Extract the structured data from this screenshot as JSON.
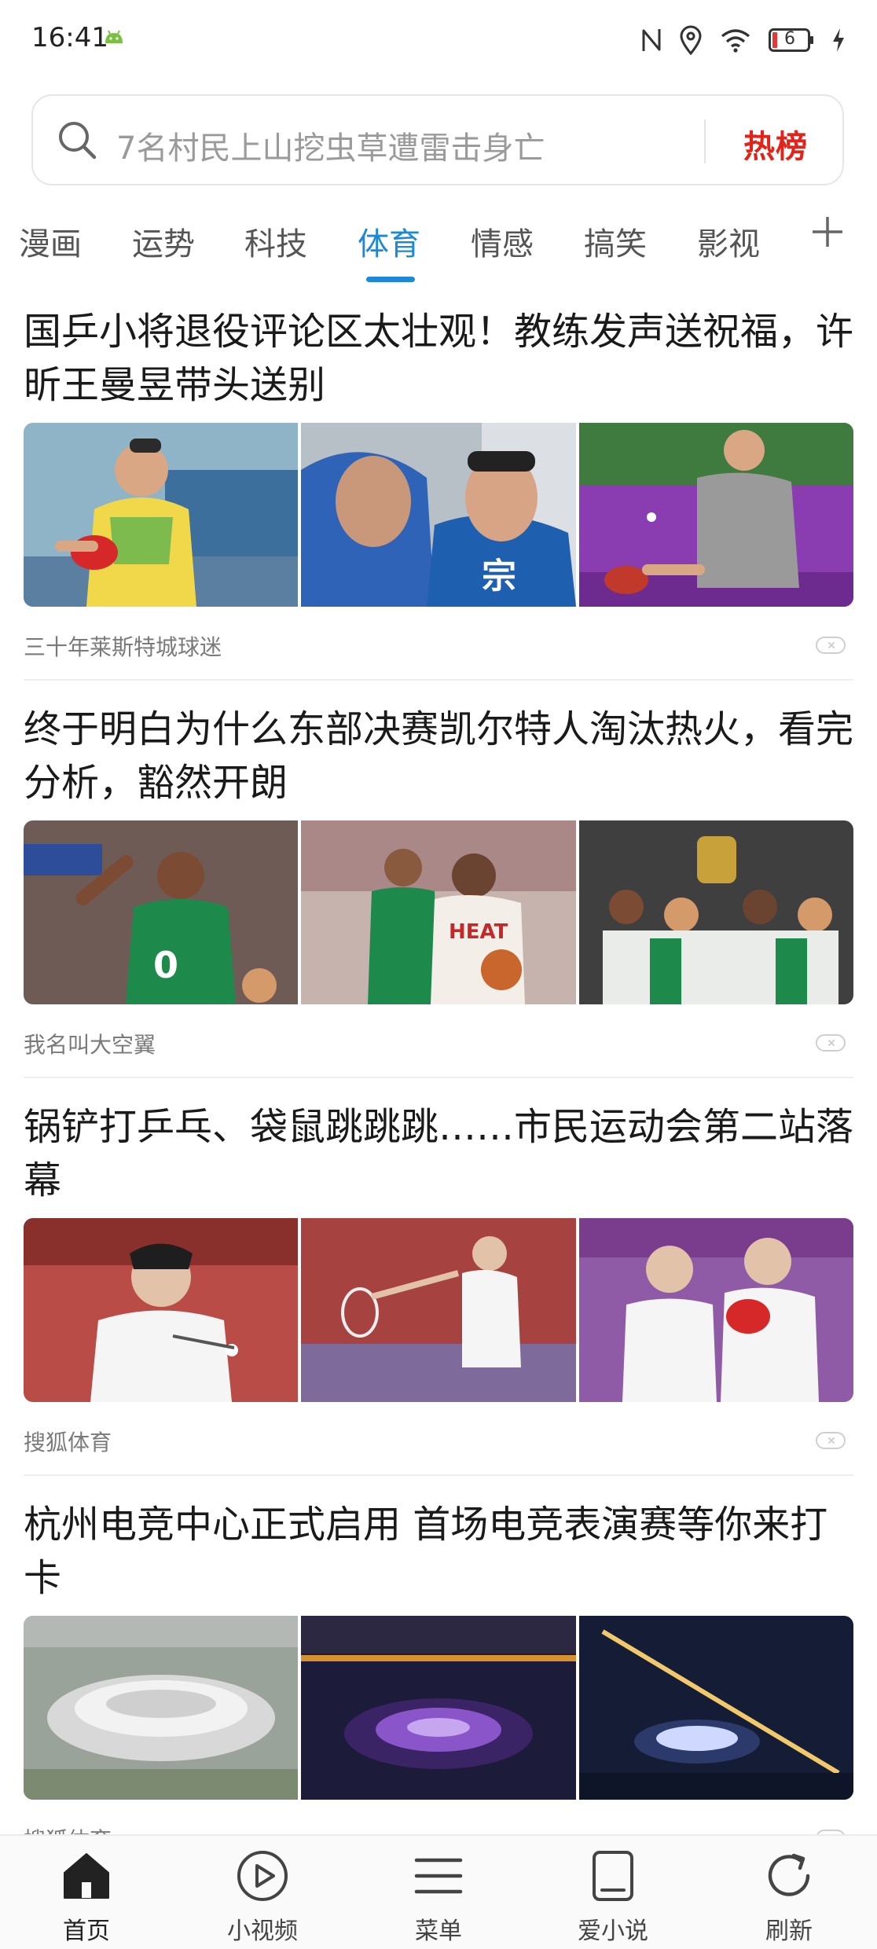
{
  "status_bar": {
    "time": "16:41",
    "battery": "6"
  },
  "search": {
    "placeholder": "7名村民上山挖虫草遭雷击身亡",
    "hot_label": "热榜"
  },
  "tabs": [
    {
      "label": "漫画"
    },
    {
      "label": "运势"
    },
    {
      "label": "科技"
    },
    {
      "label": "体育"
    },
    {
      "label": "情感"
    },
    {
      "label": "搞笑"
    },
    {
      "label": "影视"
    }
  ],
  "active_tab": "体育",
  "articles": [
    {
      "title": "国乒小将退役评论区太壮观！教练发声送祝福，许昕王曼昱带头送别",
      "source": "三十年莱斯特城球迷"
    },
    {
      "title": "终于明白为什么东部决赛凯尔特人淘汰热火，看完分析，豁然开朗",
      "source": "我名叫大空翼"
    },
    {
      "title": "锅铲打乒乓、袋鼠跳跳跳……市民运动会第二站落幕",
      "source": "搜狐体育"
    },
    {
      "title": "杭州电竞中心正式启用 首场电竞表演赛等你来打卡",
      "source": "搜狐体育"
    }
  ],
  "bottom_nav": [
    {
      "label": "首页",
      "icon": "home-icon"
    },
    {
      "label": "小视频",
      "icon": "play-circle-icon"
    },
    {
      "label": "菜单",
      "icon": "menu-icon"
    },
    {
      "label": "爱小说",
      "icon": "book-icon"
    },
    {
      "label": "刷新",
      "icon": "refresh-icon"
    }
  ],
  "colors": {
    "accent": "#1e88d8",
    "hot": "#e2231a"
  }
}
